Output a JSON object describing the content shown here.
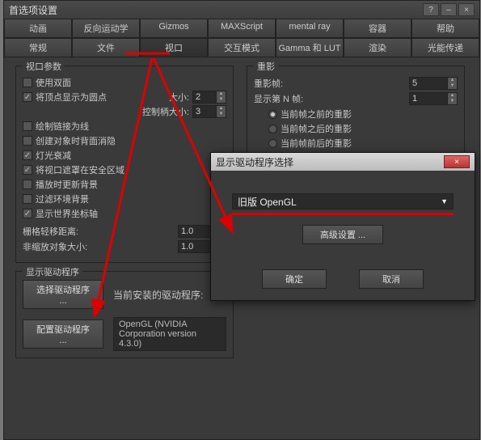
{
  "main": {
    "title": "首选项设置",
    "tabs_row1": [
      "动画",
      "反向运动学",
      "Gizmos",
      "MAXScript",
      "mental ray",
      "容器",
      "帮助"
    ],
    "tabs_row2": [
      "常规",
      "文件",
      "视口",
      "交互模式",
      "Gamma 和 LUT",
      "渲染",
      "光能传递"
    ],
    "active_tab": "视口",
    "viewport_params": {
      "title": "视口参数",
      "use_dual_plane": "使用双面",
      "vertex_as_dot": "将顶点显示为圆点",
      "size_label": "大小:",
      "size_value": "2",
      "handle_size_label": "控制柄大小:",
      "handle_size_value": "3",
      "draw_links": "绘制链接为线",
      "backface_cull": "创建对象时背面消隐",
      "light_atten": "灯光衰减",
      "mask_safe": "将视口遮罩在安全区域",
      "update_bg": "播放时更新背景",
      "filter_env": "过滤环境背景",
      "show_world_axis": "显示世界坐标轴",
      "grid_dist_label": "栅格轻移距离:",
      "grid_dist_value": "1.0",
      "nonscale_label": "非缩放对象大小:",
      "nonscale_value": "1.0"
    },
    "ghosting": {
      "title": "重影",
      "frames_label": "重影帧:",
      "frames_value": "5",
      "nth_label": "显示第 N 帧:",
      "nth_value": "1",
      "before": "当前帧之前的重影",
      "after": "当前帧之后的重影",
      "both": "当前帧前后的重影"
    },
    "driver": {
      "title": "显示驱动程序",
      "choose_btn": "选择驱动程序 ...",
      "config_btn": "配置驱动程序 ...",
      "current_label": "当前安装的驱动程序:",
      "current_value": "OpenGL (NVIDIA Corporation version 4.3.0)"
    }
  },
  "modal": {
    "title": "显示驱动程序选择",
    "selected": "旧版 OpenGL",
    "advanced": "高级设置 ...",
    "ok": "确定",
    "cancel": "取消"
  }
}
